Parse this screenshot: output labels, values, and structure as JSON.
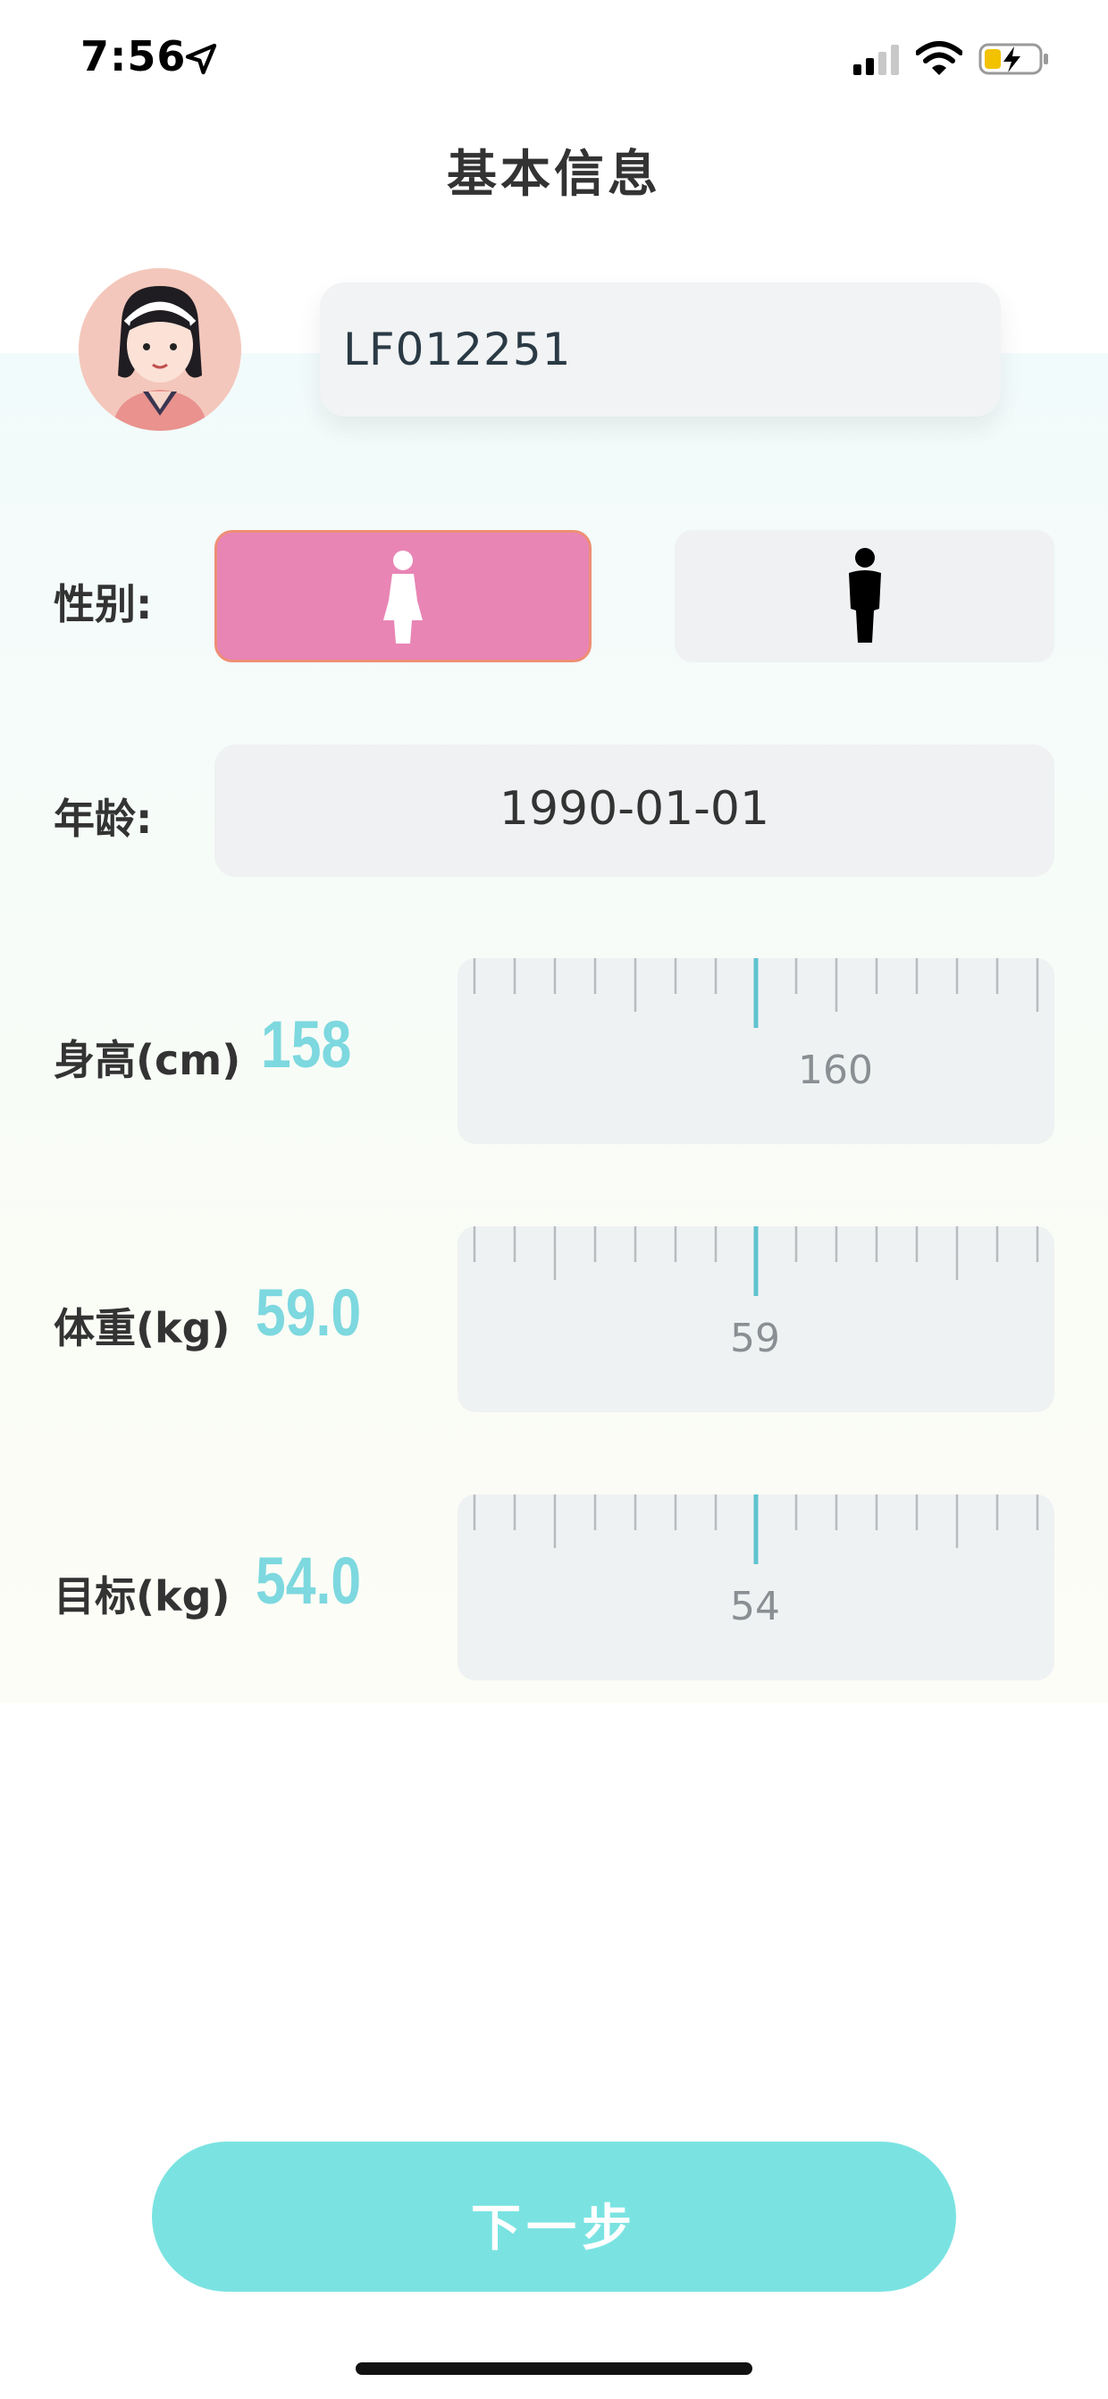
{
  "status_bar": {
    "time": "7:56"
  },
  "header": {
    "title": "基本信息"
  },
  "profile": {
    "user_id": "LF012251"
  },
  "gender": {
    "label": "性别:",
    "selected": "female"
  },
  "age": {
    "label": "年龄:",
    "value": "1990-01-01"
  },
  "height": {
    "label": "身高(cm)",
    "value": "158",
    "ruler_label": "160"
  },
  "weight": {
    "label": "体重(kg)",
    "value": "59.0",
    "ruler_label": "59"
  },
  "target": {
    "label": "目标(kg)",
    "value": "54.0",
    "ruler_label": "54"
  },
  "actions": {
    "next_label": "下一步"
  },
  "colors": {
    "accent": "#7dd8df",
    "female_button": "#e885b5",
    "button": "#7ae3e1"
  }
}
